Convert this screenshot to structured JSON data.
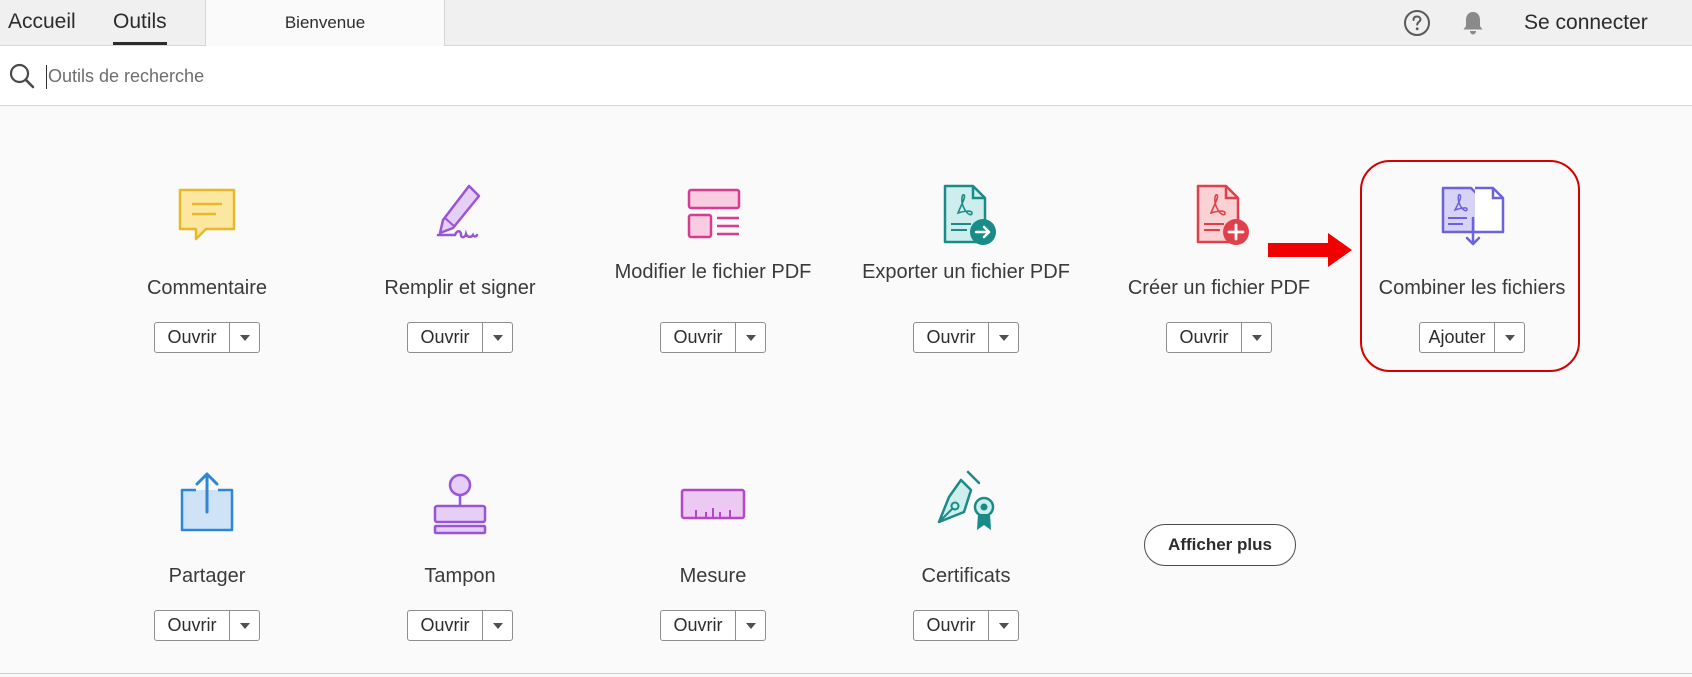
{
  "nav": {
    "home": "Accueil",
    "tools": "Outils",
    "document_tab": "Bienvenue",
    "help_icon": "question-circle-icon",
    "bell_icon": "notification-bell-icon",
    "signin": "Se connecter"
  },
  "search": {
    "placeholder": "Outils de recherche",
    "value": ""
  },
  "tools": [
    {
      "name": "Commentaire",
      "button": "Ouvrir",
      "icon": "comment-icon",
      "color": "#e8b827"
    },
    {
      "name": "Remplir et signer",
      "button": "Ouvrir",
      "icon": "fill-sign-pen-icon",
      "color": "#9a55d6"
    },
    {
      "name": "Modifier le fichier PDF",
      "button": "Ouvrir",
      "icon": "edit-pdf-icon",
      "color": "#d63d8f"
    },
    {
      "name": "Exporter un fichier PDF",
      "button": "Ouvrir",
      "icon": "export-pdf-icon",
      "color": "#1a8b88"
    },
    {
      "name": "Créer un fichier PDF",
      "button": "Ouvrir",
      "icon": "create-pdf-icon",
      "color": "#e0404b"
    },
    {
      "name": "Combiner les fichiers",
      "button": "Ajouter",
      "icon": "combine-files-icon",
      "color": "#6b63d9"
    },
    {
      "name": "Partager",
      "button": "Ouvrir",
      "icon": "share-upload-icon",
      "color": "#2f86d6"
    },
    {
      "name": "Tampon",
      "button": "Ouvrir",
      "icon": "stamp-icon",
      "color": "#9a55d6"
    },
    {
      "name": "Mesure",
      "button": "Ouvrir",
      "icon": "ruler-measure-icon",
      "color": "#b545c9"
    },
    {
      "name": "Certificats",
      "button": "Ouvrir",
      "icon": "certificate-pen-icon",
      "color": "#1a8b88"
    }
  ],
  "show_more": "Afficher plus",
  "annotation": {
    "highlight_color": "#d40000",
    "arrow_color": "#f00000"
  }
}
